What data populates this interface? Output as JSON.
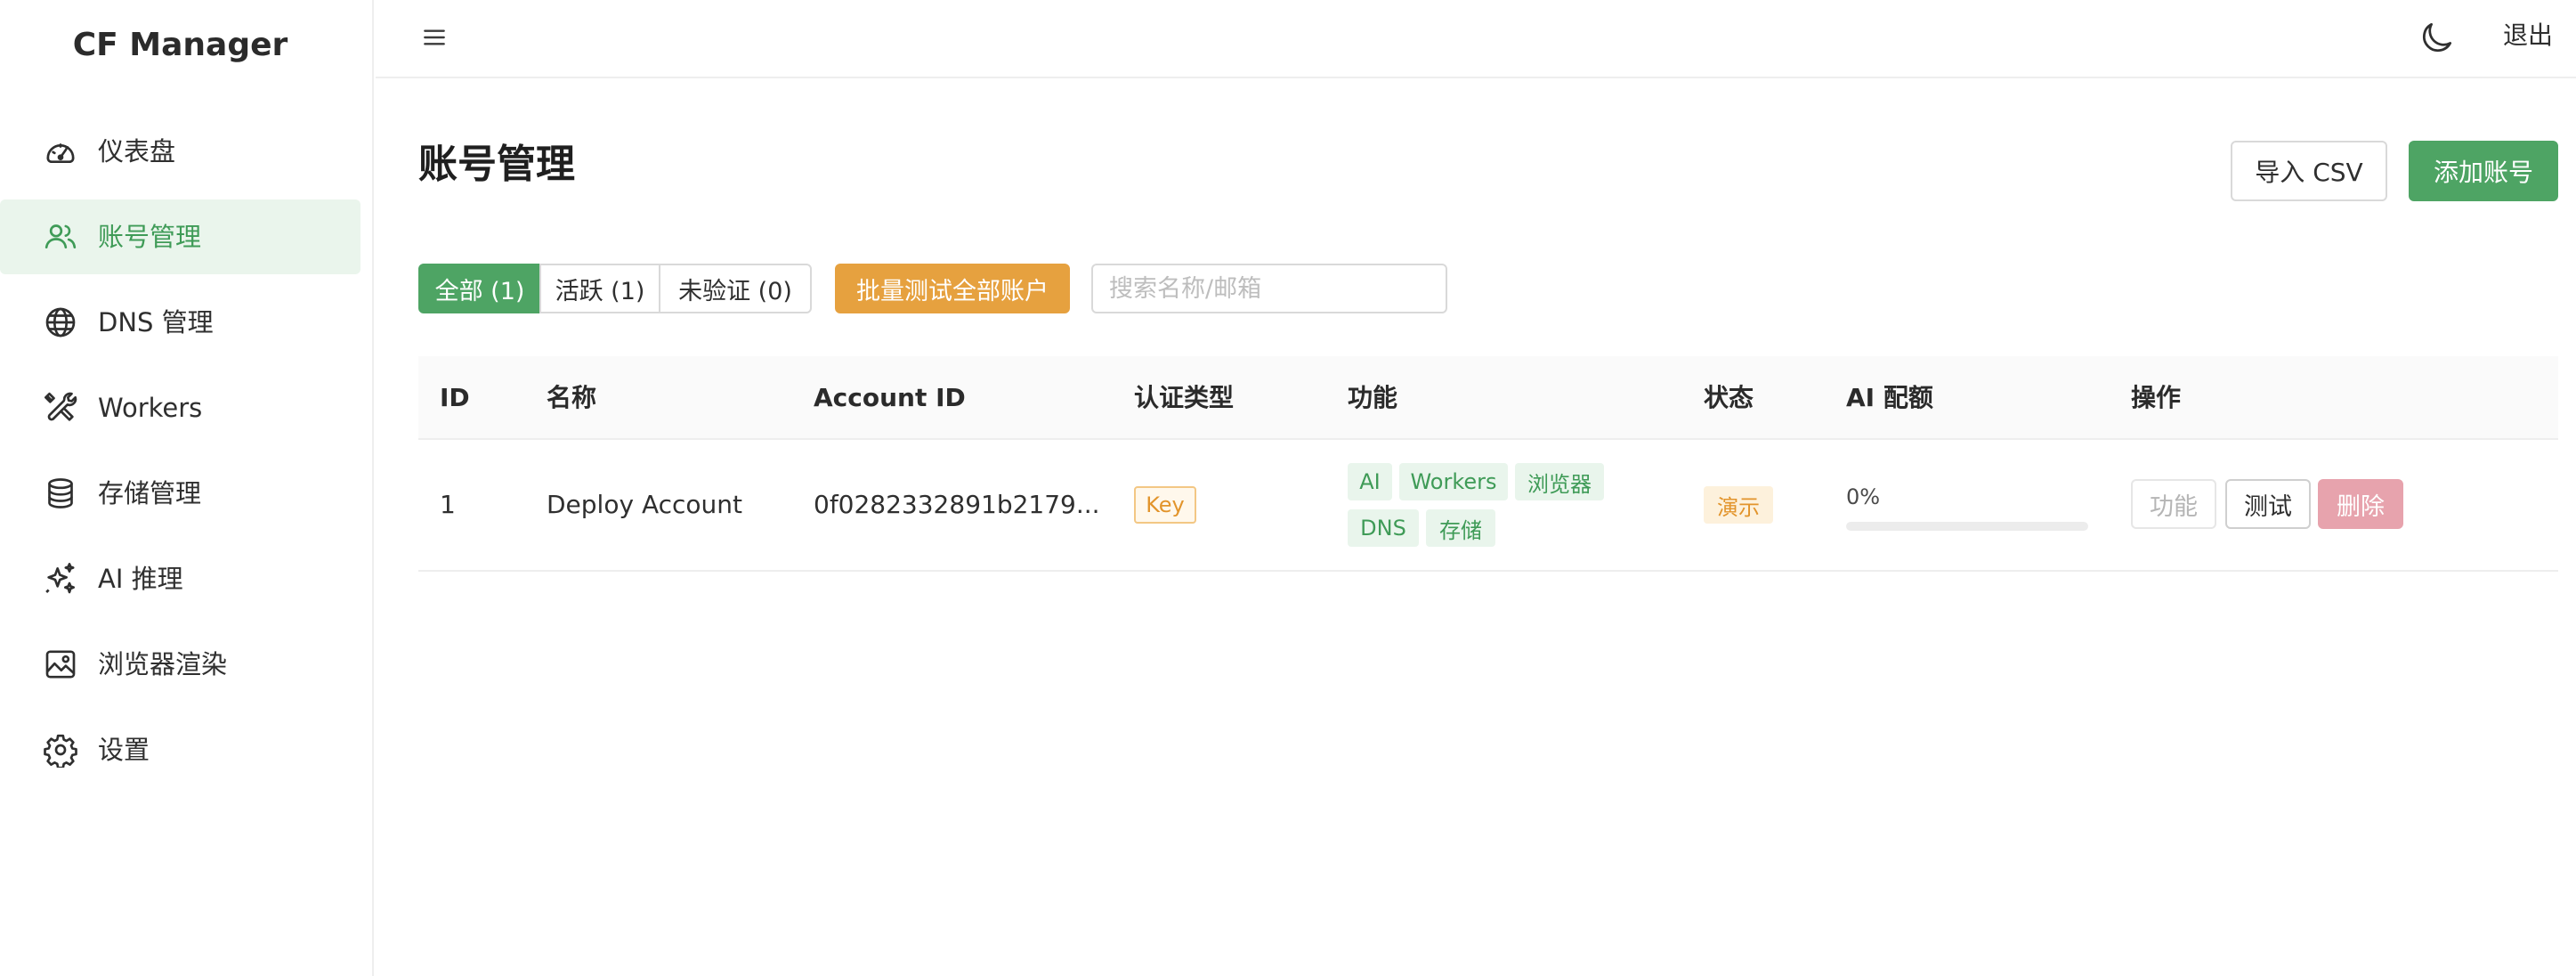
{
  "sidebar": {
    "brand": "CF Manager",
    "items": [
      {
        "label": "仪表盘",
        "icon": "dashboard-icon"
      },
      {
        "label": "账号管理",
        "icon": "users-icon",
        "active": true
      },
      {
        "label": "DNS 管理",
        "icon": "globe-icon"
      },
      {
        "label": "Workers",
        "icon": "tools-icon"
      },
      {
        "label": "存储管理",
        "icon": "database-icon"
      },
      {
        "label": "AI 推理",
        "icon": "sparkle-icon"
      },
      {
        "label": "浏览器渲染",
        "icon": "image-icon"
      },
      {
        "label": "设置",
        "icon": "gear-icon"
      }
    ]
  },
  "header": {
    "logout": "退出"
  },
  "main": {
    "title": "账号管理",
    "import_label": "导入 CSV",
    "add_label": "添加账号",
    "filters": {
      "all": "全部 (1)",
      "active": "活跃 (1)",
      "unverified": "未验证 (0)"
    },
    "batch_test_label": "批量测试全部账户",
    "search_placeholder": "搜索名称/邮箱"
  },
  "table": {
    "columns": [
      "ID",
      "名称",
      "Account ID",
      "认证类型",
      "功能",
      "状态",
      "AI 配额",
      "操作"
    ],
    "rows": [
      {
        "id": "1",
        "name": "Deploy Account",
        "account_id": "0f0282332891b2179...",
        "auth_type": "Key",
        "features": [
          "AI",
          "Workers",
          "浏览器",
          "DNS",
          "存储"
        ],
        "status": "演示",
        "ai_quota_label": "0%",
        "ai_quota_fraction": 0,
        "actions": {
          "features": "功能",
          "test": "测试",
          "delete": "删除"
        }
      }
    ]
  },
  "colors": {
    "accent": "#4ea464",
    "warning": "#e6a13f",
    "danger": "#e7a3ad",
    "active_bg": "#eaf5ec"
  }
}
